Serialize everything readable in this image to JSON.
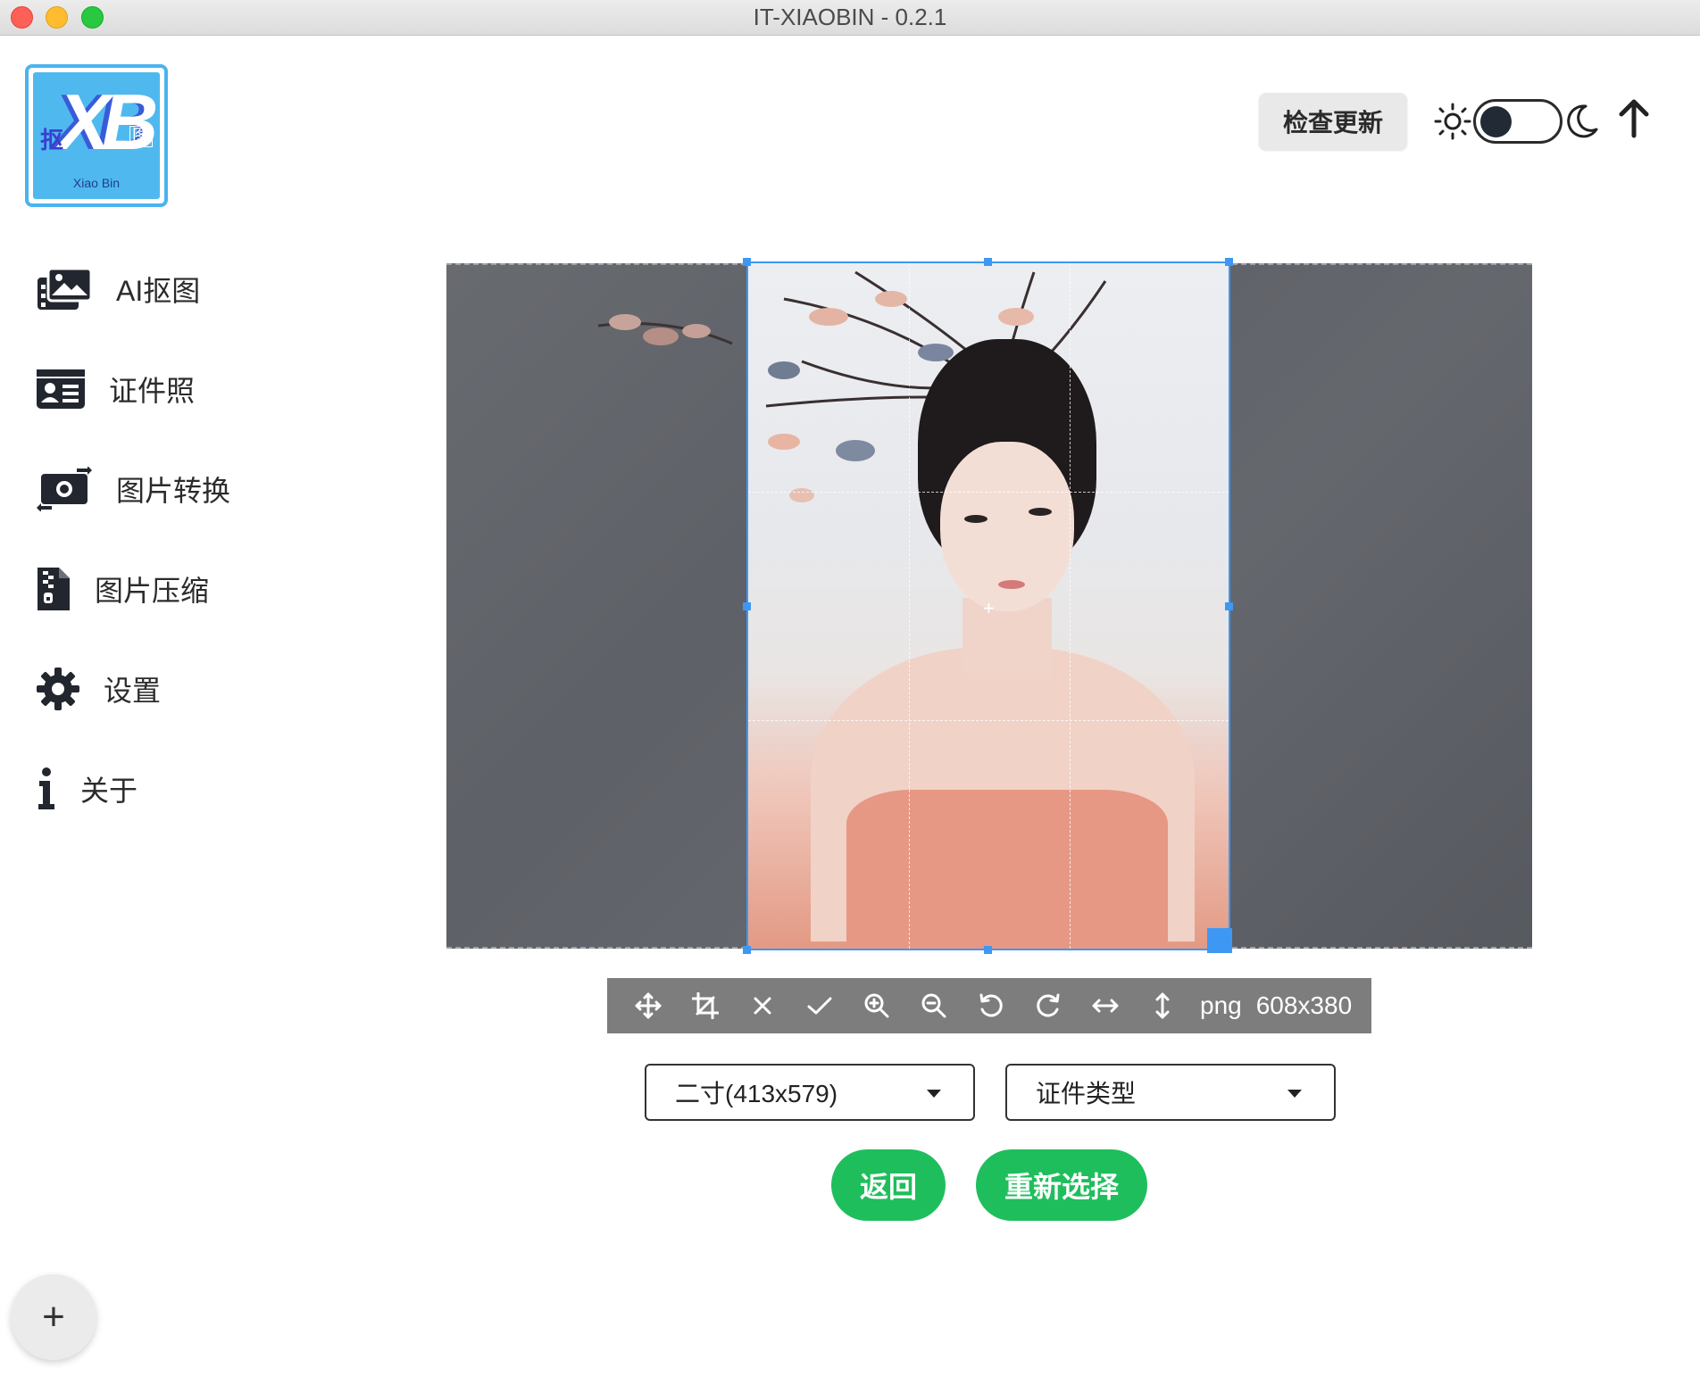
{
  "window": {
    "title": "IT-XIAOBIN - 0.2.1"
  },
  "logo": {
    "main": "XB",
    "left_char": "抠",
    "right_char": "图",
    "subtitle": "Xiao Bin"
  },
  "sidebar": {
    "items": [
      {
        "label": "AI抠图",
        "icon": "images-icon"
      },
      {
        "label": "证件照",
        "icon": "id-card-icon"
      },
      {
        "label": "图片转换",
        "icon": "money-bill-transfer-icon"
      },
      {
        "label": "图片压缩",
        "icon": "file-zipper-icon"
      },
      {
        "label": "设置",
        "icon": "gear-icon"
      },
      {
        "label": "关于",
        "icon": "info-icon"
      }
    ],
    "add_label": "+"
  },
  "header": {
    "check_update": "检查更新",
    "theme": {
      "mode": "light",
      "light_icon": "sun-icon",
      "dark_icon": "moon-icon"
    },
    "up_icon": "arrow-up-icon"
  },
  "editor": {
    "accent_color": "#3d98f3",
    "toolbar": {
      "tools": [
        "move-icon",
        "crop-icon",
        "close-icon",
        "check-icon",
        "zoom-in-icon",
        "zoom-out-icon",
        "rotate-left-icon",
        "rotate-right-icon",
        "flip-horizontal-icon",
        "flip-vertical-icon"
      ],
      "format": "png",
      "size": "608x380"
    },
    "size_select": {
      "value": "二寸(413x579)"
    },
    "type_select": {
      "value": "证件类型"
    }
  },
  "actions": {
    "back": "返回",
    "reselect": "重新选择",
    "color": "#1fbe5c"
  }
}
